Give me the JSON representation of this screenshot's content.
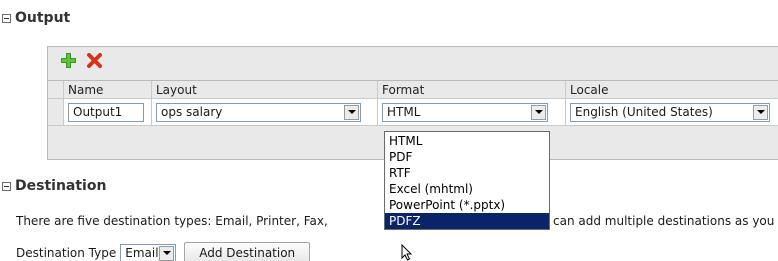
{
  "output_section": {
    "title": "Output",
    "toolbar": {
      "add_icon": "plus-icon",
      "delete_icon": "x-icon",
      "add_color": "#3a9a1f",
      "delete_color": "#d9321c"
    },
    "columns": [
      "Name",
      "Layout",
      "Format",
      "Locale"
    ],
    "row": {
      "name": "Output1",
      "layout": "ops salary",
      "format": "HTML",
      "locale": "English (United States)"
    },
    "format_options": [
      "HTML",
      "PDF",
      "RTF",
      "Excel (mhtml)",
      "PowerPoint (*.pptx)",
      "PDFZ"
    ],
    "format_highlighted": "PDFZ"
  },
  "destination_section": {
    "title": "Destination",
    "description_left": "There are five destination types: Email, Printer, Fax,",
    "description_right": "can add multiple destinations as you",
    "type_label": "Destination Type",
    "type_value": "Email",
    "add_button": "Add Destination"
  },
  "colors": {
    "selection": "#0a246a",
    "panel": "#e9e9e9"
  }
}
